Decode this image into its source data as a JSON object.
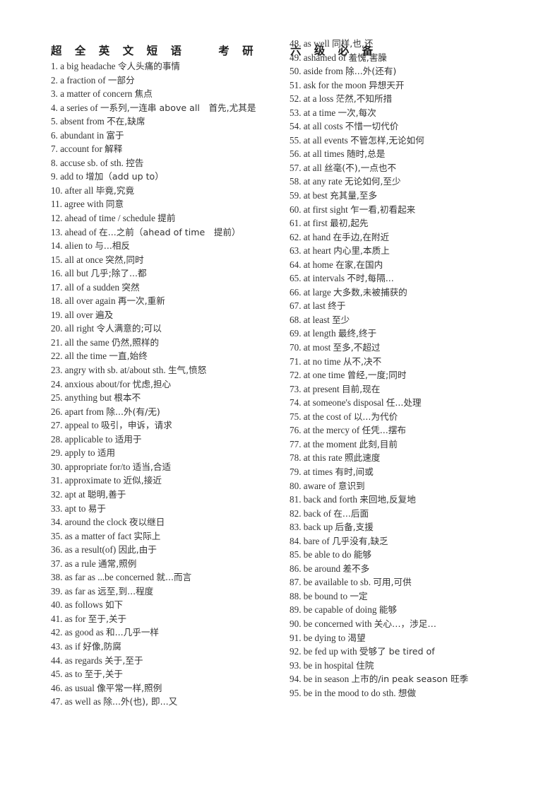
{
  "document": {
    "title": "超 全 英 文 短 语 　 考 研 　 六 级 必 备",
    "page_background": "#ffffff",
    "text_color": "#333333"
  },
  "left_column": {
    "entries": [
      {
        "num": "1.",
        "en": "a big headache",
        "cn": "令人头痛的事情"
      },
      {
        "num": "2.",
        "en": "a fraction of",
        "cn": "一部分"
      },
      {
        "num": "3.",
        "en": "a matter of concern",
        "cn": "焦点"
      },
      {
        "num": "4.",
        "en": "a series of",
        "cn": "一系列,一连串 above all　首先,尤其是"
      },
      {
        "num": "5.",
        "en": "absent from",
        "cn": "不在,缺席"
      },
      {
        "num": "6.",
        "en": "abundant in",
        "cn": "富于"
      },
      {
        "num": "7.",
        "en": "account for",
        "cn": "解释"
      },
      {
        "num": "8.",
        "en": "accuse sb. of sth.",
        "cn": "控告"
      },
      {
        "num": "9.",
        "en": "add to",
        "cn": "增加（add up to）"
      },
      {
        "num": "10.",
        "en": "after all",
        "cn": "毕竟,究竟"
      },
      {
        "num": "11.",
        "en": "agree with",
        "cn": "同意"
      },
      {
        "num": "12.",
        "en": "ahead of time / schedule",
        "cn": "提前"
      },
      {
        "num": "13.",
        "en": "ahead of",
        "cn": "在...之前（ahead of time　提前）"
      },
      {
        "num": "14.",
        "en": "alien to",
        "cn": "与...相反"
      },
      {
        "num": "15.",
        "en": "all at once",
        "cn": "突然,同时"
      },
      {
        "num": "16.",
        "en": "all but",
        "cn": "几乎;除了...都"
      },
      {
        "num": "17.",
        "en": "all of a sudden",
        "cn": "突然"
      },
      {
        "num": "18.",
        "en": "all over again",
        "cn": "再一次,重新"
      },
      {
        "num": "19.",
        "en": "all over",
        "cn": "遍及"
      },
      {
        "num": "20.",
        "en": "all right",
        "cn": "令人满意的;可以"
      },
      {
        "num": "21.",
        "en": "all the same",
        "cn": "仍然,照样的"
      },
      {
        "num": "22.",
        "en": "all the time",
        "cn": "一直,始终"
      },
      {
        "num": "23.",
        "en": "angry with sb. at/about sth.",
        "cn": "生气,愤怒"
      },
      {
        "num": "24.",
        "en": "anxious about/for",
        "cn": "忧虑,担心"
      },
      {
        "num": "25.",
        "en": "anything but",
        "cn": "根本不"
      },
      {
        "num": "26.",
        "en": "apart from",
        "cn": "除...外(有/无)"
      },
      {
        "num": "27.",
        "en": "appeal to",
        "cn": "吸引，申诉，请求"
      },
      {
        "num": "28.",
        "en": "applicable to",
        "cn": "适用于"
      },
      {
        "num": "29.",
        "en": "apply to",
        "cn": "适用"
      },
      {
        "num": "30.",
        "en": "appropriate for/to",
        "cn": "适当,合适"
      },
      {
        "num": "31.",
        "en": "approximate to",
        "cn": "近似,接近"
      },
      {
        "num": "32.",
        "en": "apt at",
        "cn": "聪明,善于"
      },
      {
        "num": "33.",
        "en": "apt to",
        "cn": "易于"
      },
      {
        "num": "34.",
        "en": "around the clock",
        "cn": "夜以继日"
      },
      {
        "num": "35.",
        "en": "as a matter of fact",
        "cn": "实际上"
      },
      {
        "num": "36.",
        "en": "as a result(of)",
        "cn": "因此,由于"
      },
      {
        "num": "37.",
        "en": "as a rule",
        "cn": "通常,照例"
      },
      {
        "num": "38.",
        "en": "as far as ...be concerned",
        "cn": "就...而言"
      },
      {
        "num": "39.",
        "en": "as far as",
        "cn": "远至,到...程度"
      },
      {
        "num": "40.",
        "en": "as follows",
        "cn": "如下"
      },
      {
        "num": "41.",
        "en": "as for",
        "cn": "至于,关于"
      },
      {
        "num": "42.",
        "en": "as good as",
        "cn": "和...几乎一样"
      },
      {
        "num": "43.",
        "en": "as if",
        "cn": "好像,防腐"
      },
      {
        "num": "44.",
        "en": "as regards",
        "cn": "关于,至于"
      },
      {
        "num": "45.",
        "en": "as to",
        "cn": "至于,关于"
      },
      {
        "num": "46.",
        "en": "as usual",
        "cn": "像平常一样,照例"
      },
      {
        "num": "47.",
        "en": "as well as",
        "cn": "除...外(也), 即...又"
      }
    ]
  },
  "right_column": {
    "entries": [
      {
        "num": "48.",
        "en": "as well",
        "cn": "同样,也,还"
      },
      {
        "num": "49.",
        "en": "ashamed of",
        "cn": "羞愧,害臊"
      },
      {
        "num": "50.",
        "en": "aside from",
        "cn": "除...外(还有)"
      },
      {
        "num": "51.",
        "en": "ask for the moon",
        "cn": "异想天开"
      },
      {
        "num": "52.",
        "en": "at a loss",
        "cn": "茫然,不知所措"
      },
      {
        "num": "53.",
        "en": "at a time",
        "cn": "一次,每次"
      },
      {
        "num": "54.",
        "en": "at all costs",
        "cn": "不惜一切代价"
      },
      {
        "num": "55.",
        "en": "at all events",
        "cn": "不管怎样,无论如何"
      },
      {
        "num": "56.",
        "en": "at all times",
        "cn": "随时,总是"
      },
      {
        "num": "57.",
        "en": "at all",
        "cn": "丝毫(不),一点也不"
      },
      {
        "num": "58.",
        "en": "at any rate",
        "cn": "无论如何,至少"
      },
      {
        "num": "59.",
        "en": "at best",
        "cn": "充其量,至多"
      },
      {
        "num": "60.",
        "en": "at first sight",
        "cn": "乍一看,初看起来"
      },
      {
        "num": "61.",
        "en": "at first",
        "cn": "最初,起先"
      },
      {
        "num": "62.",
        "en": "at hand",
        "cn": "在手边,在附近"
      },
      {
        "num": "63.",
        "en": "at heart",
        "cn": "内心里,本质上"
      },
      {
        "num": "64.",
        "en": "at home",
        "cn": "在家,在国内"
      },
      {
        "num": "65.",
        "en": "at intervals",
        "cn": "不时,每隔..."
      },
      {
        "num": "66.",
        "en": "at large",
        "cn": "大多数,未被捕获的"
      },
      {
        "num": "67.",
        "en": "at last",
        "cn": "终于"
      },
      {
        "num": "68.",
        "en": "at least",
        "cn": "至少"
      },
      {
        "num": "69.",
        "en": "at length",
        "cn": "最终,终于"
      },
      {
        "num": "70.",
        "en": "at most",
        "cn": "至多,不超过"
      },
      {
        "num": "71.",
        "en": "at no time",
        "cn": "从不,决不"
      },
      {
        "num": "72.",
        "en": "at one time",
        "cn": "曾经,一度;同时"
      },
      {
        "num": "73.",
        "en": "at present",
        "cn": "目前,现在"
      },
      {
        "num": "74.",
        "en": "at someone's disposal",
        "cn": "任...处理"
      },
      {
        "num": "75.",
        "en": "at the cost of",
        "cn": "以...为代价"
      },
      {
        "num": "76.",
        "en": "at the mercy of",
        "cn": "任凭...摆布"
      },
      {
        "num": "77.",
        "en": "at the moment",
        "cn": "此刻,目前"
      },
      {
        "num": "78.",
        "en": "at this rate",
        "cn": "照此速度"
      },
      {
        "num": "79.",
        "en": "at times",
        "cn": "有时,间或"
      },
      {
        "num": "80.",
        "en": "aware of",
        "cn": "意识到"
      },
      {
        "num": "81.",
        "en": "back and forth",
        "cn": "来回地,反复地"
      },
      {
        "num": "82.",
        "en": "back of",
        "cn": "在...后面"
      },
      {
        "num": "83.",
        "en": "back up",
        "cn": "后备,支援"
      },
      {
        "num": "84.",
        "en": "bare of",
        "cn": "几乎没有,缺乏"
      },
      {
        "num": "85.",
        "en": "be able to do",
        "cn": "能够"
      },
      {
        "num": "86.",
        "en": "be around",
        "cn": "差不多"
      },
      {
        "num": "87.",
        "en": "be available to sb.",
        "cn": "可用,可供"
      },
      {
        "num": "88.",
        "en": "be bound to",
        "cn": "一定"
      },
      {
        "num": "89.",
        "en": "be capable of doing",
        "cn": "能够"
      },
      {
        "num": "90.",
        "en": "be concerned with",
        "cn": "关心…，涉足…"
      },
      {
        "num": "91.",
        "en": "be dying to",
        "cn": "渴望"
      },
      {
        "num": "92.",
        "en": "be fed up with",
        "cn": "受够了 be tired of"
      },
      {
        "num": "93.",
        "en": "be in hospital",
        "cn": "住院"
      },
      {
        "num": "94.",
        "en": "be in season",
        "cn": "上市的/in peak season 旺季"
      },
      {
        "num": "95.",
        "en": "be in the mood to do sth.",
        "cn": "想做"
      }
    ]
  }
}
